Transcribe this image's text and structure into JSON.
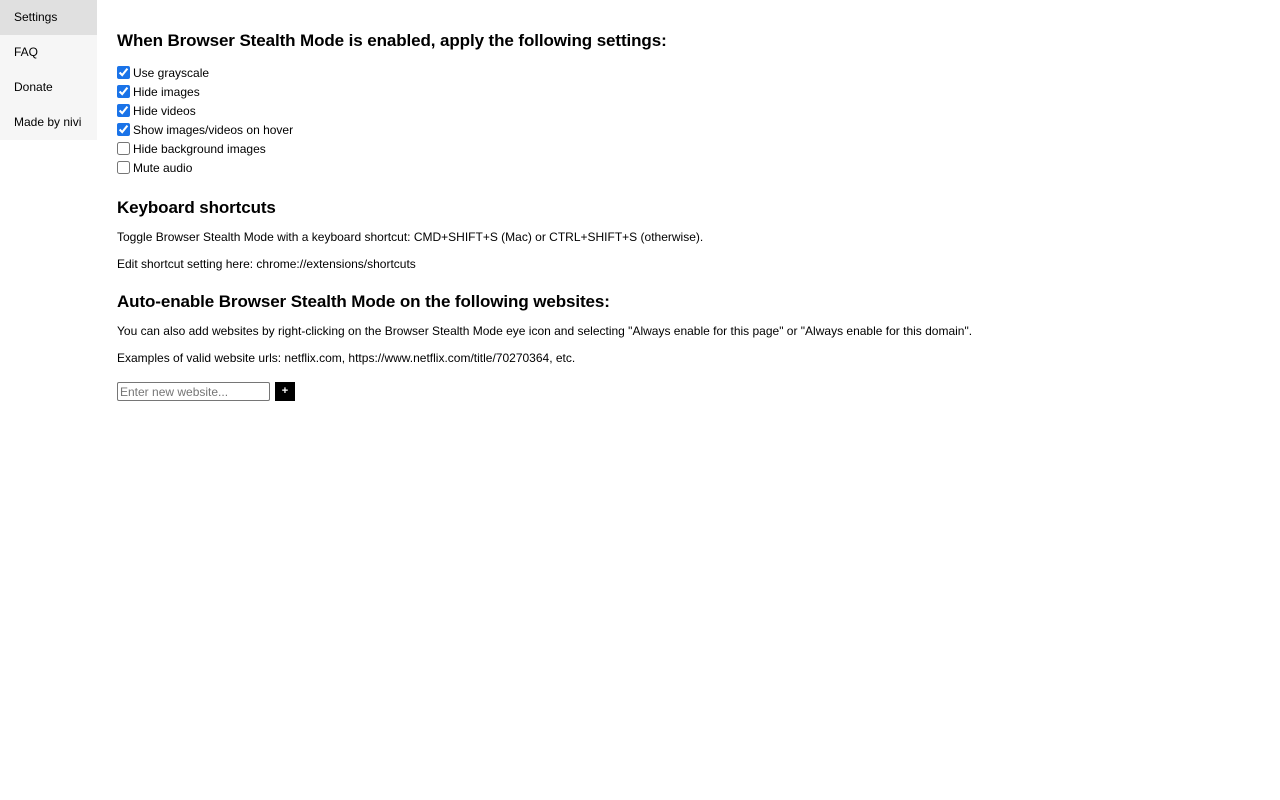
{
  "sidebar": {
    "items": [
      {
        "id": "settings",
        "label": "Settings",
        "active": true
      },
      {
        "id": "faq",
        "label": "FAQ",
        "active": false
      },
      {
        "id": "donate",
        "label": "Donate",
        "active": false
      },
      {
        "id": "made-by-nivi",
        "label": "Made by nivi",
        "active": false
      }
    ]
  },
  "main": {
    "settings_heading": "When Browser Stealth Mode is enabled, apply the following settings:",
    "checkboxes": [
      {
        "id": "use-grayscale",
        "label": "Use grayscale",
        "checked": true
      },
      {
        "id": "hide-images",
        "label": "Hide images",
        "checked": true
      },
      {
        "id": "hide-videos",
        "label": "Hide videos",
        "checked": true
      },
      {
        "id": "show-images-videos-on-hover",
        "label": "Show images/videos on hover",
        "checked": true
      },
      {
        "id": "hide-background-images",
        "label": "Hide background images",
        "checked": false
      },
      {
        "id": "mute-audio",
        "label": "Mute audio",
        "checked": false
      }
    ],
    "shortcuts_heading": "Keyboard shortcuts",
    "shortcuts_line1": "Toggle Browser Stealth Mode with a keyboard shortcut: CMD+SHIFT+S (Mac) or CTRL+SHIFT+S (otherwise).",
    "shortcuts_line2": "Edit shortcut setting here: chrome://extensions/shortcuts",
    "autoenable_heading": "Auto-enable Browser Stealth Mode on the following websites:",
    "autoenable_line1": "You can also add websites by right-clicking on the Browser Stealth Mode eye icon and selecting \"Always enable for this page\" or \"Always enable for this domain\".",
    "autoenable_line2": "Examples of valid website urls: netflix.com, https://www.netflix.com/title/70270364, etc.",
    "website_input_placeholder": "Enter new website...",
    "website_input_value": "",
    "add_button_label": "+",
    "websites": []
  },
  "colors": {
    "checkbox_accent": "#1a73e8",
    "sidebar_background": "#f6f6f6",
    "sidebar_active_background": "#e0e0e0",
    "add_button_background": "#000000",
    "page_background": "#ffffff"
  }
}
